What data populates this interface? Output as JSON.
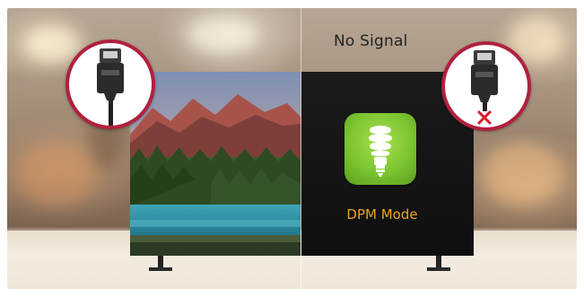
{
  "screen": {
    "no_signal_text": "No Signal",
    "dpm_mode_label": "DPM Mode"
  },
  "icons": {
    "left_badge": "hdmi-cable-connected-icon",
    "right_badge": "hdmi-cable-disconnected-icon",
    "dpm_icon": "energy-saving-bulb-icon",
    "disconnect_mark": "red-x-icon"
  },
  "colors": {
    "badge_ring": "#b0213f",
    "dpm_green": "#7cc531",
    "dpm_label": "#f2a21c",
    "disconnect_x": "#d4202f"
  }
}
